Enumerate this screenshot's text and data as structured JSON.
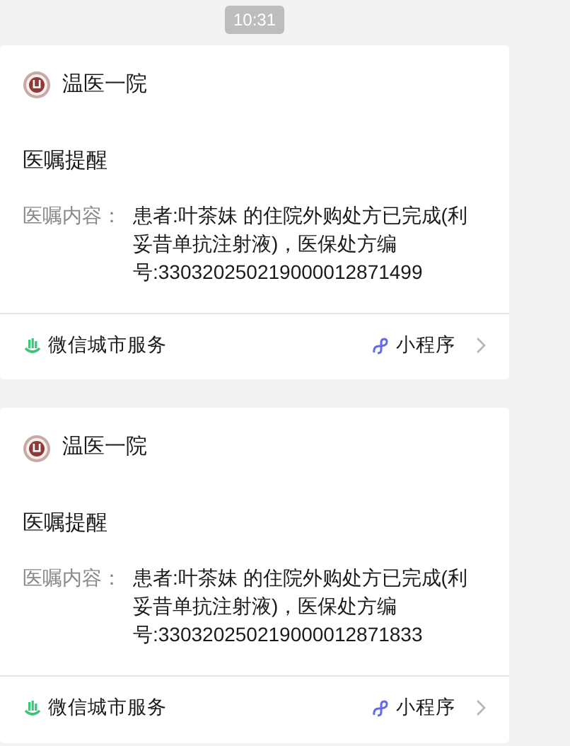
{
  "time": "10:31",
  "messages": [
    {
      "sender": "温医一院",
      "title": "医嘱提醒",
      "field_label": "医嘱内容：",
      "field_value": "患者:叶茶妹 的住院外购处方已完成(利妥昔单抗注射液)，医保处方编号:330320250219000012871499",
      "service": "微信城市服务",
      "link": "小程序"
    },
    {
      "sender": "温医一院",
      "title": "医嘱提醒",
      "field_label": "医嘱内容：",
      "field_value": "患者:叶茶妹 的住院外购处方已完成(利妥昔单抗注射液)，医保处方编号:330320250219000012871833",
      "service": "微信城市服务",
      "link": "小程序"
    }
  ]
}
